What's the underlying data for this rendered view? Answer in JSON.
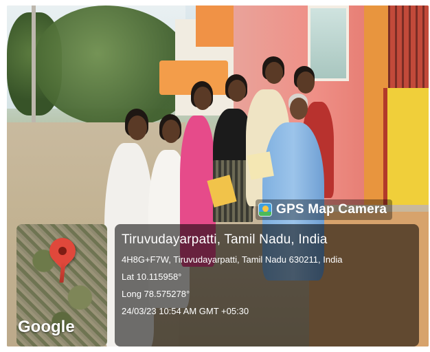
{
  "overlay": {
    "app_name": "GPS Map Camera",
    "location_title": "Tiruvudayarpatti, Tamil Nadu, India",
    "address": "4H8G+F7W, Tiruvudayarpatti, Tamil Nadu 630211, India",
    "lat": "Lat 10.115958°",
    "long": "Long 78.575278°",
    "timestamp": "24/03/23 10:54 AM GMT +05:30",
    "map_brand": "Google"
  },
  "colors": {
    "pin": "#e0483b",
    "panel_bg": "rgba(0,0,0,0.55)",
    "text": "#ffffff"
  },
  "icons": {
    "app_logo": "gps-map-camera-logo-icon",
    "map_pin": "map-pin-icon"
  }
}
